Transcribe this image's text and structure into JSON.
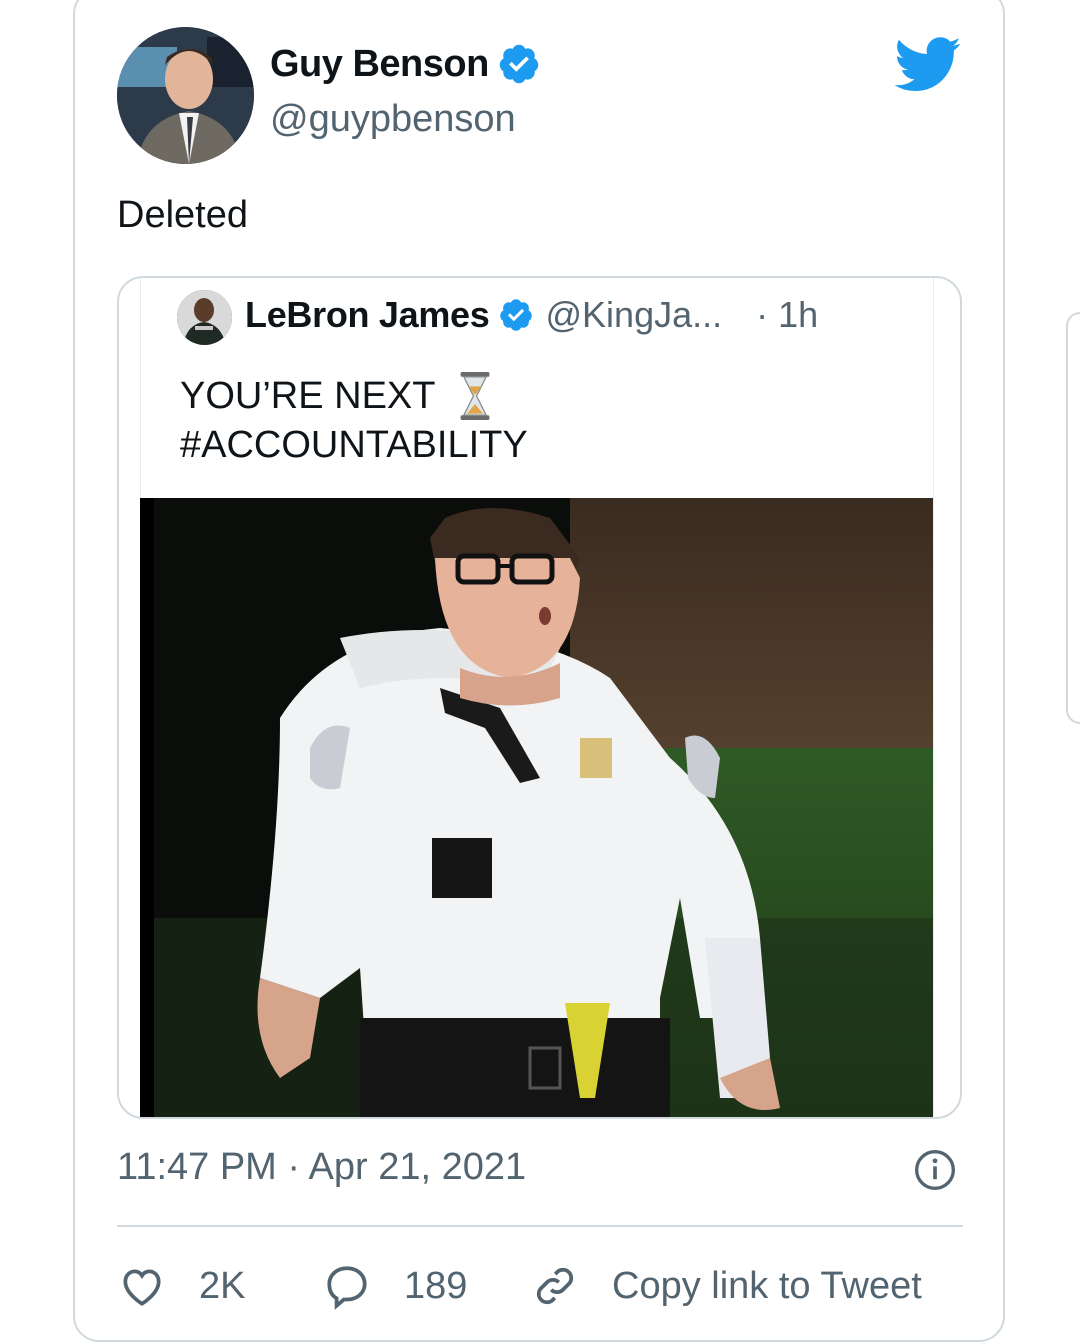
{
  "tweet": {
    "author_name": "Guy Benson",
    "author_handle": "@guypbenson",
    "text": "Deleted",
    "timestamp": "11:47 PM · Apr 21, 2021",
    "verified": true
  },
  "quoted_tweet": {
    "author_name": "LeBron James",
    "author_handle": "@KingJa...",
    "time": "· 1h",
    "line1": "YOU’RE NEXT",
    "line2": "#ACCOUNTABILITY",
    "emoji": "hourglass-icon",
    "verified": true
  },
  "actions": {
    "likes": "2K",
    "replies": "189",
    "copy_link": "Copy link to Tweet"
  },
  "icons": [
    "twitter-bird-icon",
    "verified-badge-icon",
    "info-icon",
    "heart-icon",
    "reply-icon",
    "link-icon"
  ],
  "colors": {
    "twitter_blue": "#1d9bf0",
    "text_primary": "#0f1419",
    "text_secondary": "#536471",
    "border": "#cfd9de"
  }
}
